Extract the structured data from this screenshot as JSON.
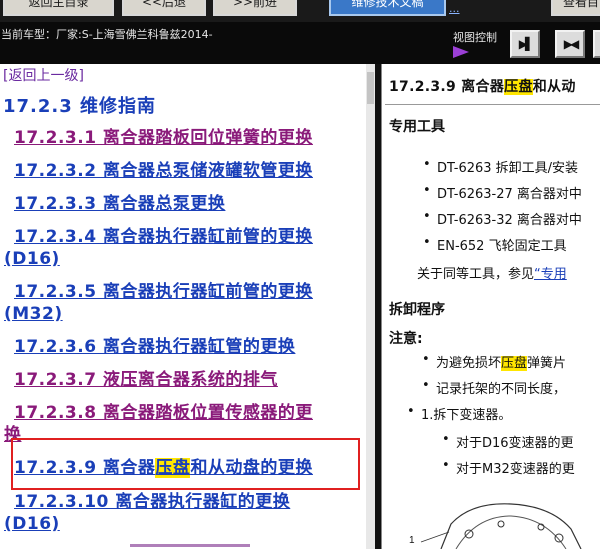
{
  "toolbar": {
    "buttons": [
      "返回主目录",
      "<<后退",
      ">>前进",
      "维修技术文稿",
      "查看目"
    ],
    "more_link": "..."
  },
  "infobar": {
    "vehicle": "当前车型：厂家:S-上海雪佛兰科鲁兹2014-",
    "view_control_label": "视图控制"
  },
  "left": {
    "back_link": "[返回上一级]",
    "section_title": "17.2.3  维修指南",
    "entries": [
      {
        "text": "17.2.3.1  离合器踏板回位弹簧的更换"
      },
      {
        "text": "17.2.3.2  离合器总泵储液罐软管更换"
      },
      {
        "text": "17.2.3.3  离合器总泵更换"
      },
      {
        "line1": "17.2.3.4  离合器执行器缸前管的更换",
        "line2": "(D16)"
      },
      {
        "line1": "17.2.3.5  离合器执行器缸前管的更换",
        "line2": "(M32)"
      },
      {
        "text": "17.2.3.6  离合器执行器缸管的更换"
      },
      {
        "text": "17.2.3.7  液压离合器系统的排气"
      },
      {
        "line1": "17.2.3.8  离合器踏板位置传感器的更",
        "line2": "换"
      },
      {
        "pre": "17.2.3.9  离合器",
        "hl": "压盘",
        "post": "和从动盘的更换"
      },
      {
        "line1": "17.2.3.10  离合器执行器缸的更换",
        "line2": "(D16)"
      }
    ]
  },
  "right": {
    "title_pre": "17.2.3.9 离合器",
    "title_hl": "压盘",
    "title_post": "和从动",
    "tools_heading": "专用工具",
    "tools": [
      "DT-6263 拆卸工具/安装",
      "DT-6263-27 离合器对中",
      "DT-6263-32 离合器对中",
      "EN-652 飞轮固定工具"
    ],
    "equiv_pre": "关于同等工具，参见",
    "equiv_link": "“专用",
    "removal_heading": "拆卸程序",
    "note_label": "注意:",
    "notes": [
      {
        "pre": "为避免损坏",
        "hl": "压盘",
        "post": "弹簧片"
      },
      {
        "text": "记录托架的不同长度，"
      }
    ],
    "step1": "1.拆下变速器。",
    "substeps": [
      "对于D16变速器的更",
      "对于M32变速器的更"
    ],
    "diagram_label": "1"
  }
}
